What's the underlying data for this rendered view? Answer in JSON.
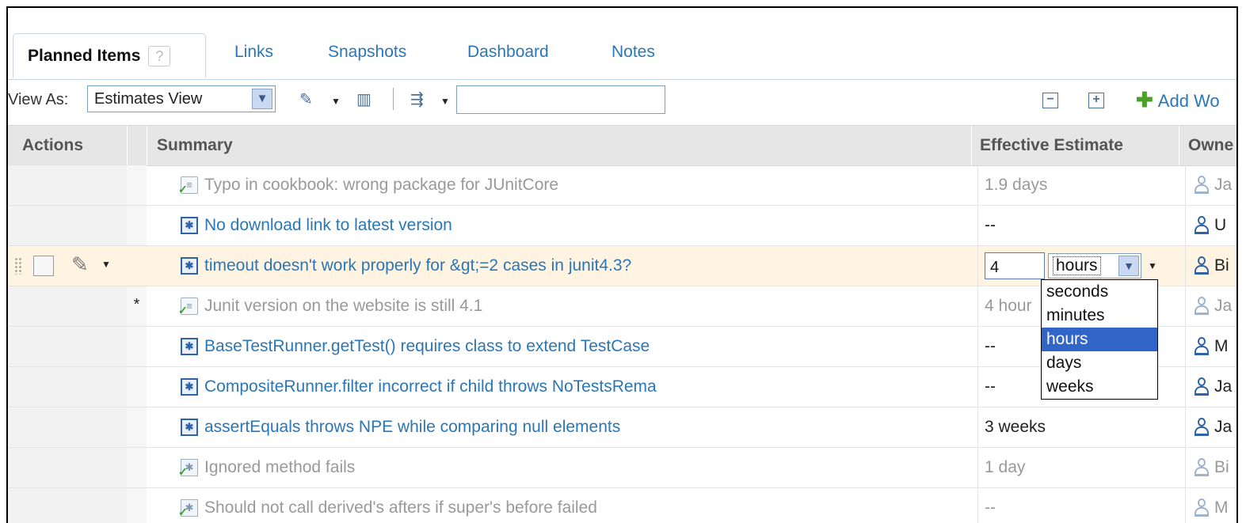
{
  "tabs": [
    {
      "label": "Planned Items",
      "active": true
    },
    {
      "label": "Links"
    },
    {
      "label": "Snapshots"
    },
    {
      "label": "Dashboard"
    },
    {
      "label": "Notes"
    }
  ],
  "help_glyph": "?",
  "toolbar": {
    "view_as_label": "View As:",
    "view_select": "Estimates View",
    "search_value": "",
    "add_work_label": "Add Wo"
  },
  "columns": {
    "actions": "Actions",
    "summary": "Summary",
    "estimate": "Effective Estimate",
    "owner": "Owne"
  },
  "rows": [
    {
      "type": "task-done",
      "marker": "",
      "summary": "Typo in cookbook: wrong package for JUnitCore",
      "estimate": "1.9 days",
      "owner": "Ja",
      "muted": true
    },
    {
      "type": "defect",
      "marker": "",
      "summary": "No download link to latest version",
      "estimate": "--",
      "owner": "U",
      "muted": false
    },
    {
      "type": "defect",
      "marker": "",
      "summary": "timeout doesn't work properly for &gt;=2 cases in junit4.3?",
      "estimate": "",
      "owner": "Bi",
      "muted": false,
      "selected": true
    },
    {
      "type": "task-done",
      "marker": "*",
      "summary": "Junit version on the website is still 4.1",
      "estimate": "4 hour",
      "owner": "Ja",
      "muted": true
    },
    {
      "type": "defect",
      "marker": "",
      "summary": "BaseTestRunner.getTest() requires class to extend TestCase",
      "estimate": "--",
      "owner": "M",
      "muted": false
    },
    {
      "type": "defect",
      "marker": "",
      "summary": "CompositeRunner.filter incorrect if child throws NoTestsRema",
      "estimate": "--",
      "owner": "Ja",
      "muted": false
    },
    {
      "type": "defect",
      "marker": "",
      "summary": "assertEquals throws NPE while comparing null elements",
      "estimate": "3 weeks",
      "owner": "Ja",
      "muted": false,
      "dark_estimate": true
    },
    {
      "type": "defect-done",
      "marker": "",
      "summary": "Ignored method fails",
      "estimate": "1 day",
      "owner": "Bi",
      "muted": true
    },
    {
      "type": "defect-done",
      "marker": "",
      "summary": "Should not call derived's afters if super's before failed",
      "estimate": "--",
      "owner": "M",
      "muted": true
    }
  ],
  "editor": {
    "value": "4",
    "unit": "hours",
    "options": [
      "seconds",
      "minutes",
      "hours",
      "days",
      "weeks"
    ]
  },
  "icons": {
    "edit": "edit-icon",
    "columns": "columns-icon",
    "filter": "filter-icon",
    "collapse": "collapse-all-icon",
    "expand": "expand-all-icon",
    "add": "add-icon",
    "task": "task-icon",
    "defect": "defect-icon",
    "user": "user-icon"
  },
  "colors": {
    "link": "#2a76b7",
    "selected_row": "#fff4e2",
    "dropdown_selected": "#3165c7"
  }
}
